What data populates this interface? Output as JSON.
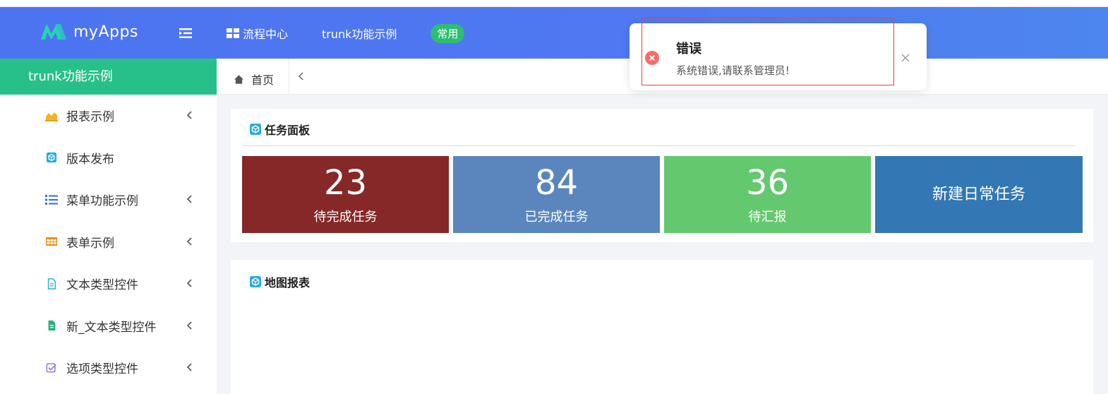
{
  "header": {
    "app_name": "myApps",
    "nav": [
      {
        "label": "流程中心",
        "icon": "grid-icon"
      },
      {
        "label": "trunk功能示例"
      },
      {
        "label": "常用",
        "style": "pill"
      }
    ]
  },
  "sidebar": {
    "title": "trunk功能示例",
    "items": [
      {
        "label": "报表示例",
        "icon": "chart-area-icon",
        "expandable": true
      },
      {
        "label": "版本发布",
        "icon": "cube-icon",
        "expandable": false
      },
      {
        "label": "菜单功能示例",
        "icon": "list-icon",
        "expandable": true
      },
      {
        "label": "表单示例",
        "icon": "table-icon",
        "expandable": true
      },
      {
        "label": "文本类型控件",
        "icon": "file-outline-icon",
        "expandable": true
      },
      {
        "label": "新_文本类型控件",
        "icon": "file-solid-icon",
        "expandable": true
      },
      {
        "label": "选项类型控件",
        "icon": "checkbox-icon",
        "expandable": true
      }
    ]
  },
  "breadcrumb": {
    "home": "首页"
  },
  "task_panel": {
    "title": "任务面板",
    "stats": [
      {
        "value": "23",
        "label": "待完成任务",
        "color": "#862828"
      },
      {
        "value": "84",
        "label": "已完成任务",
        "color": "#5a86bd"
      },
      {
        "value": "36",
        "label": "待汇报",
        "color": "#64c86e"
      }
    ],
    "action": {
      "label": "新建日常任务",
      "color": "#3377b4"
    }
  },
  "map_panel": {
    "title": "地图报表"
  },
  "toast": {
    "title": "错误",
    "message": "系统错误,请联系管理员!"
  },
  "colors": {
    "header": "#4f78f2",
    "sidebar_active": "#27c08b",
    "pill": "#2ebd73",
    "error": "#f56c6c"
  }
}
